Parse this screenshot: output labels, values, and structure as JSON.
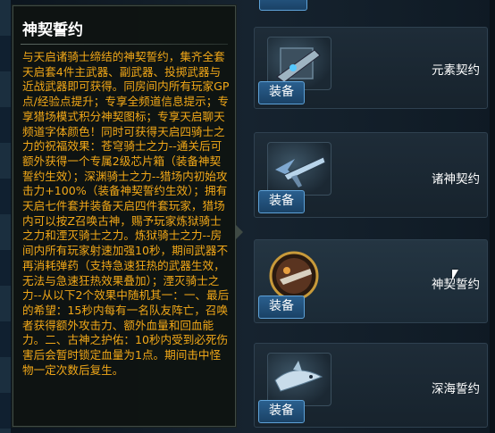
{
  "tooltip": {
    "title": "神契誓约",
    "description": "与天启诸骑士缔结的神契誓约，集齐全套天启套4件主武器、副武器、投掷武器与近战武器即可获得。同房间内所有玩家GP点/经验点提升；专享全频道信息提示；专享猎场模式积分神契图标；专享天启聊天频道字体颜色！同时可获得天启四骑士之力的祝福效果：苍穹骑士之力--通关后可额外获得一个专属2级芯片箱（装备神契誓约生效）；深渊骑士之力--猎场内初始攻击力+100%（装备神契誓约生效）；拥有天启七件套并装备天启四件套玩家，猎场内可以按Z召唤古神，赐予玩家炼狱骑士之力和湮灭骑士之力。炼狱骑士之力--房间内所有玩家射速加强10秒，期间武器不再消耗弹药（支持急速狂热的武器生效，无法与急速狂热效果叠加）；湮灭骑士之力--从以下2个效果中随机其一：一、最后的希望：15秒内每有一名队友阵亡，召唤者获得额外攻击力、额外血量和回血能力。二、古神之护佑：10秒内受到必死伤害后会暂时锁定血量为1点。期间击中怪物一定次数后复生。"
  },
  "cards": [
    {
      "name": "元素契约",
      "equip_label": "装备",
      "icon": "gun-blueprint-icon"
    },
    {
      "name": "诸神契约",
      "equip_label": "装备",
      "icon": "winged-rifle-icon"
    },
    {
      "name": "神契誓约",
      "equip_label": "装备",
      "icon": "round-emblem-icon"
    },
    {
      "name": "深海誓约",
      "equip_label": "装备",
      "icon": "shark-icon"
    }
  ]
}
